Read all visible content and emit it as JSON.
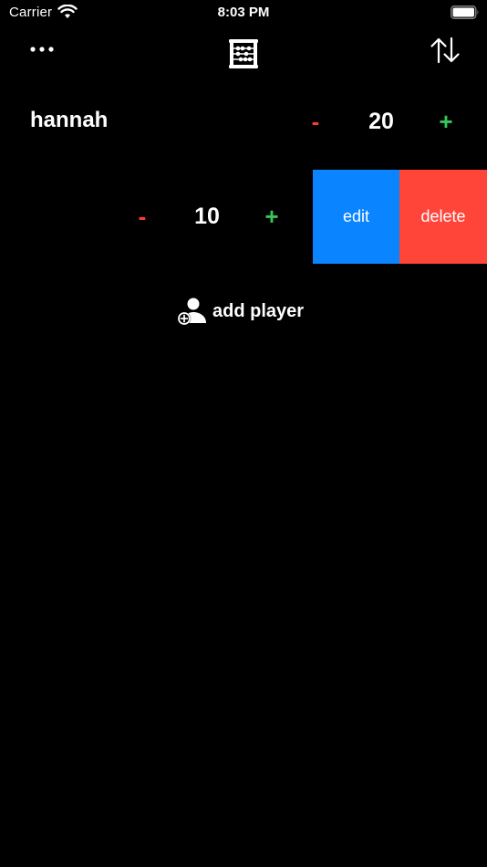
{
  "status_bar": {
    "carrier": "Carrier",
    "time": "8:03 PM",
    "icons": [
      "wifi-icon",
      "battery-icon"
    ]
  },
  "nav": {
    "left_icon": "ellipsis-icon",
    "center_icon": "abacus-icon",
    "right_icon": "sort-arrows-icon"
  },
  "players": [
    {
      "name": "hannah",
      "minus_label": "-",
      "score": "20",
      "plus_label": "+"
    },
    {
      "name": "",
      "minus_label": "-",
      "score": "10",
      "plus_label": "+",
      "actions": {
        "edit_label": "edit",
        "delete_label": "delete"
      }
    }
  ],
  "add_player": {
    "label": "add player",
    "icon": "add-person-icon"
  },
  "colors": {
    "background": "#000000",
    "minus": "#ff3b30",
    "plus": "#34c759",
    "edit": "#0a84ff",
    "delete": "#ff453a",
    "text": "#ffffff"
  }
}
